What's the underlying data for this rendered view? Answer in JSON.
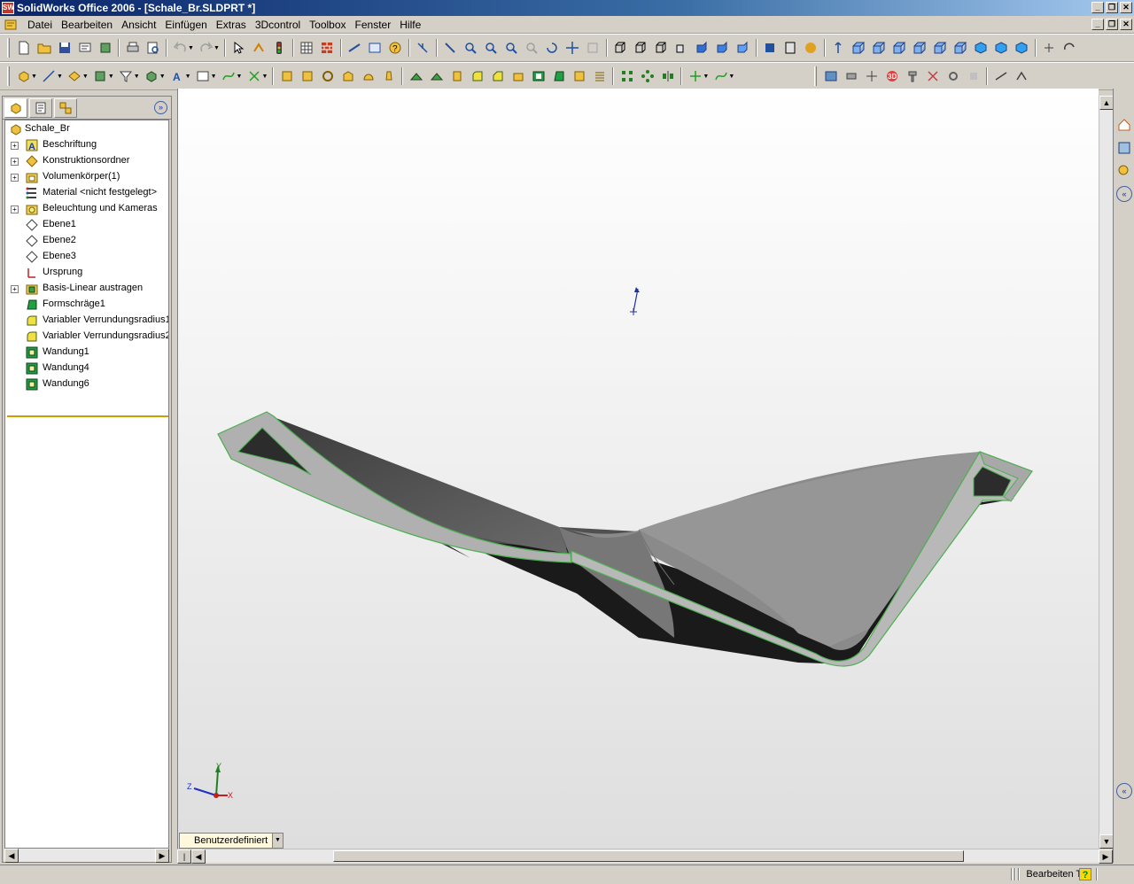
{
  "window": {
    "title": "SolidWorks Office 2006 - [Schale_Br.SLDPRT *]",
    "app_icon": "solidworks-logo-icon"
  },
  "menu": {
    "items": [
      "Datei",
      "Bearbeiten",
      "Ansicht",
      "Einfügen",
      "Extras",
      "3Dcontrol",
      "Toolbox",
      "Fenster",
      "Hilfe"
    ]
  },
  "feature_tree": {
    "root": "Schale_Br",
    "items": [
      {
        "label": "Beschriftung",
        "icon": "annotation-icon",
        "expandable": true
      },
      {
        "label": "Konstruktionsordner",
        "icon": "design-binder-icon",
        "expandable": true
      },
      {
        "label": "Volumenkörper(1)",
        "icon": "solid-bodies-folder-icon",
        "expandable": true
      },
      {
        "label": "Material <nicht festgelegt>",
        "icon": "material-icon",
        "expandable": false
      },
      {
        "label": "Beleuchtung und Kameras",
        "icon": "lighting-folder-icon",
        "expandable": true
      },
      {
        "label": "Ebene1",
        "icon": "plane-icon",
        "expandable": false
      },
      {
        "label": "Ebene2",
        "icon": "plane-icon",
        "expandable": false
      },
      {
        "label": "Ebene3",
        "icon": "plane-icon",
        "expandable": false
      },
      {
        "label": "Ursprung",
        "icon": "origin-icon",
        "expandable": false
      },
      {
        "label": "Basis-Linear austragen",
        "icon": "extrude-icon",
        "expandable": true
      },
      {
        "label": "Formschräge1",
        "icon": "draft-icon",
        "expandable": false
      },
      {
        "label": "Variabler Verrundungsradius1",
        "icon": "fillet-icon",
        "expandable": false
      },
      {
        "label": "Variabler Verrundungsradius2",
        "icon": "fillet-icon",
        "expandable": false
      },
      {
        "label": "Wandung1",
        "icon": "shell-icon",
        "expandable": false
      },
      {
        "label": "Wandung4",
        "icon": "shell-icon",
        "expandable": false
      },
      {
        "label": "Wandung6",
        "icon": "shell-icon",
        "expandable": false
      }
    ]
  },
  "view": {
    "orientation": "Benutzerdefiniert",
    "triad": {
      "x": "X",
      "y": "Y",
      "z": "Z"
    }
  },
  "status": {
    "mode": "Bearbeiten Teil",
    "help": "?"
  },
  "colors": {
    "title_start": "#0a246a",
    "model_edge": "#4caf50",
    "tree_end_marker": "#c8a000"
  }
}
